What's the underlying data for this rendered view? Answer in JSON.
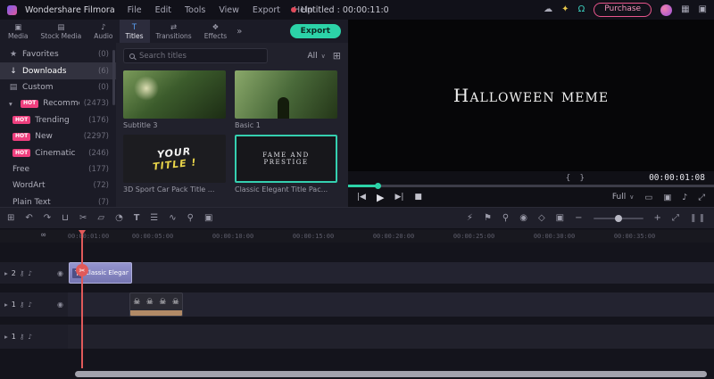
{
  "menubar": {
    "app_name": "Wondershare Filmora",
    "menus": [
      "File",
      "Edit",
      "Tools",
      "View",
      "Export",
      "Help"
    ],
    "project_title": "Untitled : 00:00:11:0",
    "purchase_label": "Purchase"
  },
  "tabs_bar": {
    "tabs": [
      {
        "label": "Media"
      },
      {
        "label": "Stock Media"
      },
      {
        "label": "Audio"
      },
      {
        "label": "Titles"
      },
      {
        "label": "Transitions"
      },
      {
        "label": "Effects"
      }
    ],
    "export_label": "Export"
  },
  "sidebar": {
    "items": [
      {
        "label": "Favorites",
        "count": "(0)"
      },
      {
        "label": "Downloads",
        "count": "(6)"
      },
      {
        "label": "Custom",
        "count": "(0)"
      },
      {
        "label": "Recommended",
        "count": "(2473)",
        "badge": "HOT"
      },
      {
        "label": "Trending",
        "count": "(176)",
        "badge": "HOT"
      },
      {
        "label": "New",
        "count": "(2297)",
        "badge": "HOT"
      },
      {
        "label": "Cinematic",
        "count": "(246)",
        "badge": "HOT"
      },
      {
        "label": "Free",
        "count": "(177)"
      },
      {
        "label": "WordArt",
        "count": "(72)"
      },
      {
        "label": "Plain Text",
        "count": "(7)"
      }
    ]
  },
  "search": {
    "placeholder": "Search titles",
    "filter_label": "All"
  },
  "thumbnails": [
    {
      "label": "Subtitle 3"
    },
    {
      "label": "Basic 1"
    },
    {
      "label": "3D Sport Car Pack Title ...",
      "preview_line1": "YOUR",
      "preview_line2": "TITLE !"
    },
    {
      "label": "Classic Elegant Title Pac...",
      "preview_text": "FAME AND PRESTIGE"
    }
  ],
  "preview": {
    "video_text": "Halloween meme",
    "timecode": "00:00:01:08",
    "quality_label": "Full"
  },
  "timeline": {
    "ruler_labels": [
      "00:00:01:00",
      "00:00:05:00",
      "00:00:10:00",
      "00:00:15:00",
      "00:00:20:00",
      "00:00:25:00",
      "00:00:30:00",
      "00:00:35:00"
    ],
    "tracks": [
      {
        "number": "2"
      },
      {
        "number": "1"
      },
      {
        "number": "1"
      }
    ],
    "title_clip_label": "Classic Elegant Tit"
  },
  "colors": {
    "accent_teal": "#2cd3a8",
    "purchase_pink": "#e8558c",
    "hot_badge": "#ee3f7e",
    "playhead_red": "#e05a5a",
    "clip_purple": "#8a8ac9",
    "selection_teal": "#35d0b0"
  },
  "icons": {
    "cloud": "☁",
    "tips": "✦",
    "support": "Ω",
    "layout": "▦",
    "screenshot": "▣",
    "tab_media": "▣",
    "tab_stock": "▤",
    "tab_audio": "♪",
    "tab_titles": "T",
    "tab_transitions": "⇄",
    "tab_effects": "❖",
    "more": "»",
    "dropdown": "∨",
    "grid_view": "⊞",
    "favorites": "★",
    "download": "↓",
    "custom": "▤",
    "expand": "▾",
    "prev_frame": "|◀",
    "play": "▶",
    "next_frame": "▶|",
    "stop": "■",
    "brace_open": "{",
    "brace_close": "}",
    "fit_display": "▭",
    "snapshot": "▣",
    "volume": "♪",
    "fullscreen": "⤢",
    "workspace": "⊞",
    "undo": "↶",
    "redo": "↷",
    "delete": "⊔",
    "split": "✂",
    "crop": "▱",
    "speed": "◔",
    "text_tool": "T",
    "adjust": "☰",
    "denoise": "∿",
    "mic": "⚲",
    "screen_rec": "▣",
    "render": "⚡",
    "marker": "⚑",
    "voiceover": "⚲",
    "record": "◉",
    "keyframe": "◇",
    "export_frame": "▣",
    "zoom_out": "−",
    "zoom_in": "+",
    "fit_timeline": "⤢",
    "track_height": "❚❚",
    "link": "∞",
    "collapse": "▸",
    "lock": "⚷",
    "speaker": "♪",
    "eye": "◉",
    "clip_text": "T",
    "skull": "☠",
    "scissors": "✂"
  }
}
